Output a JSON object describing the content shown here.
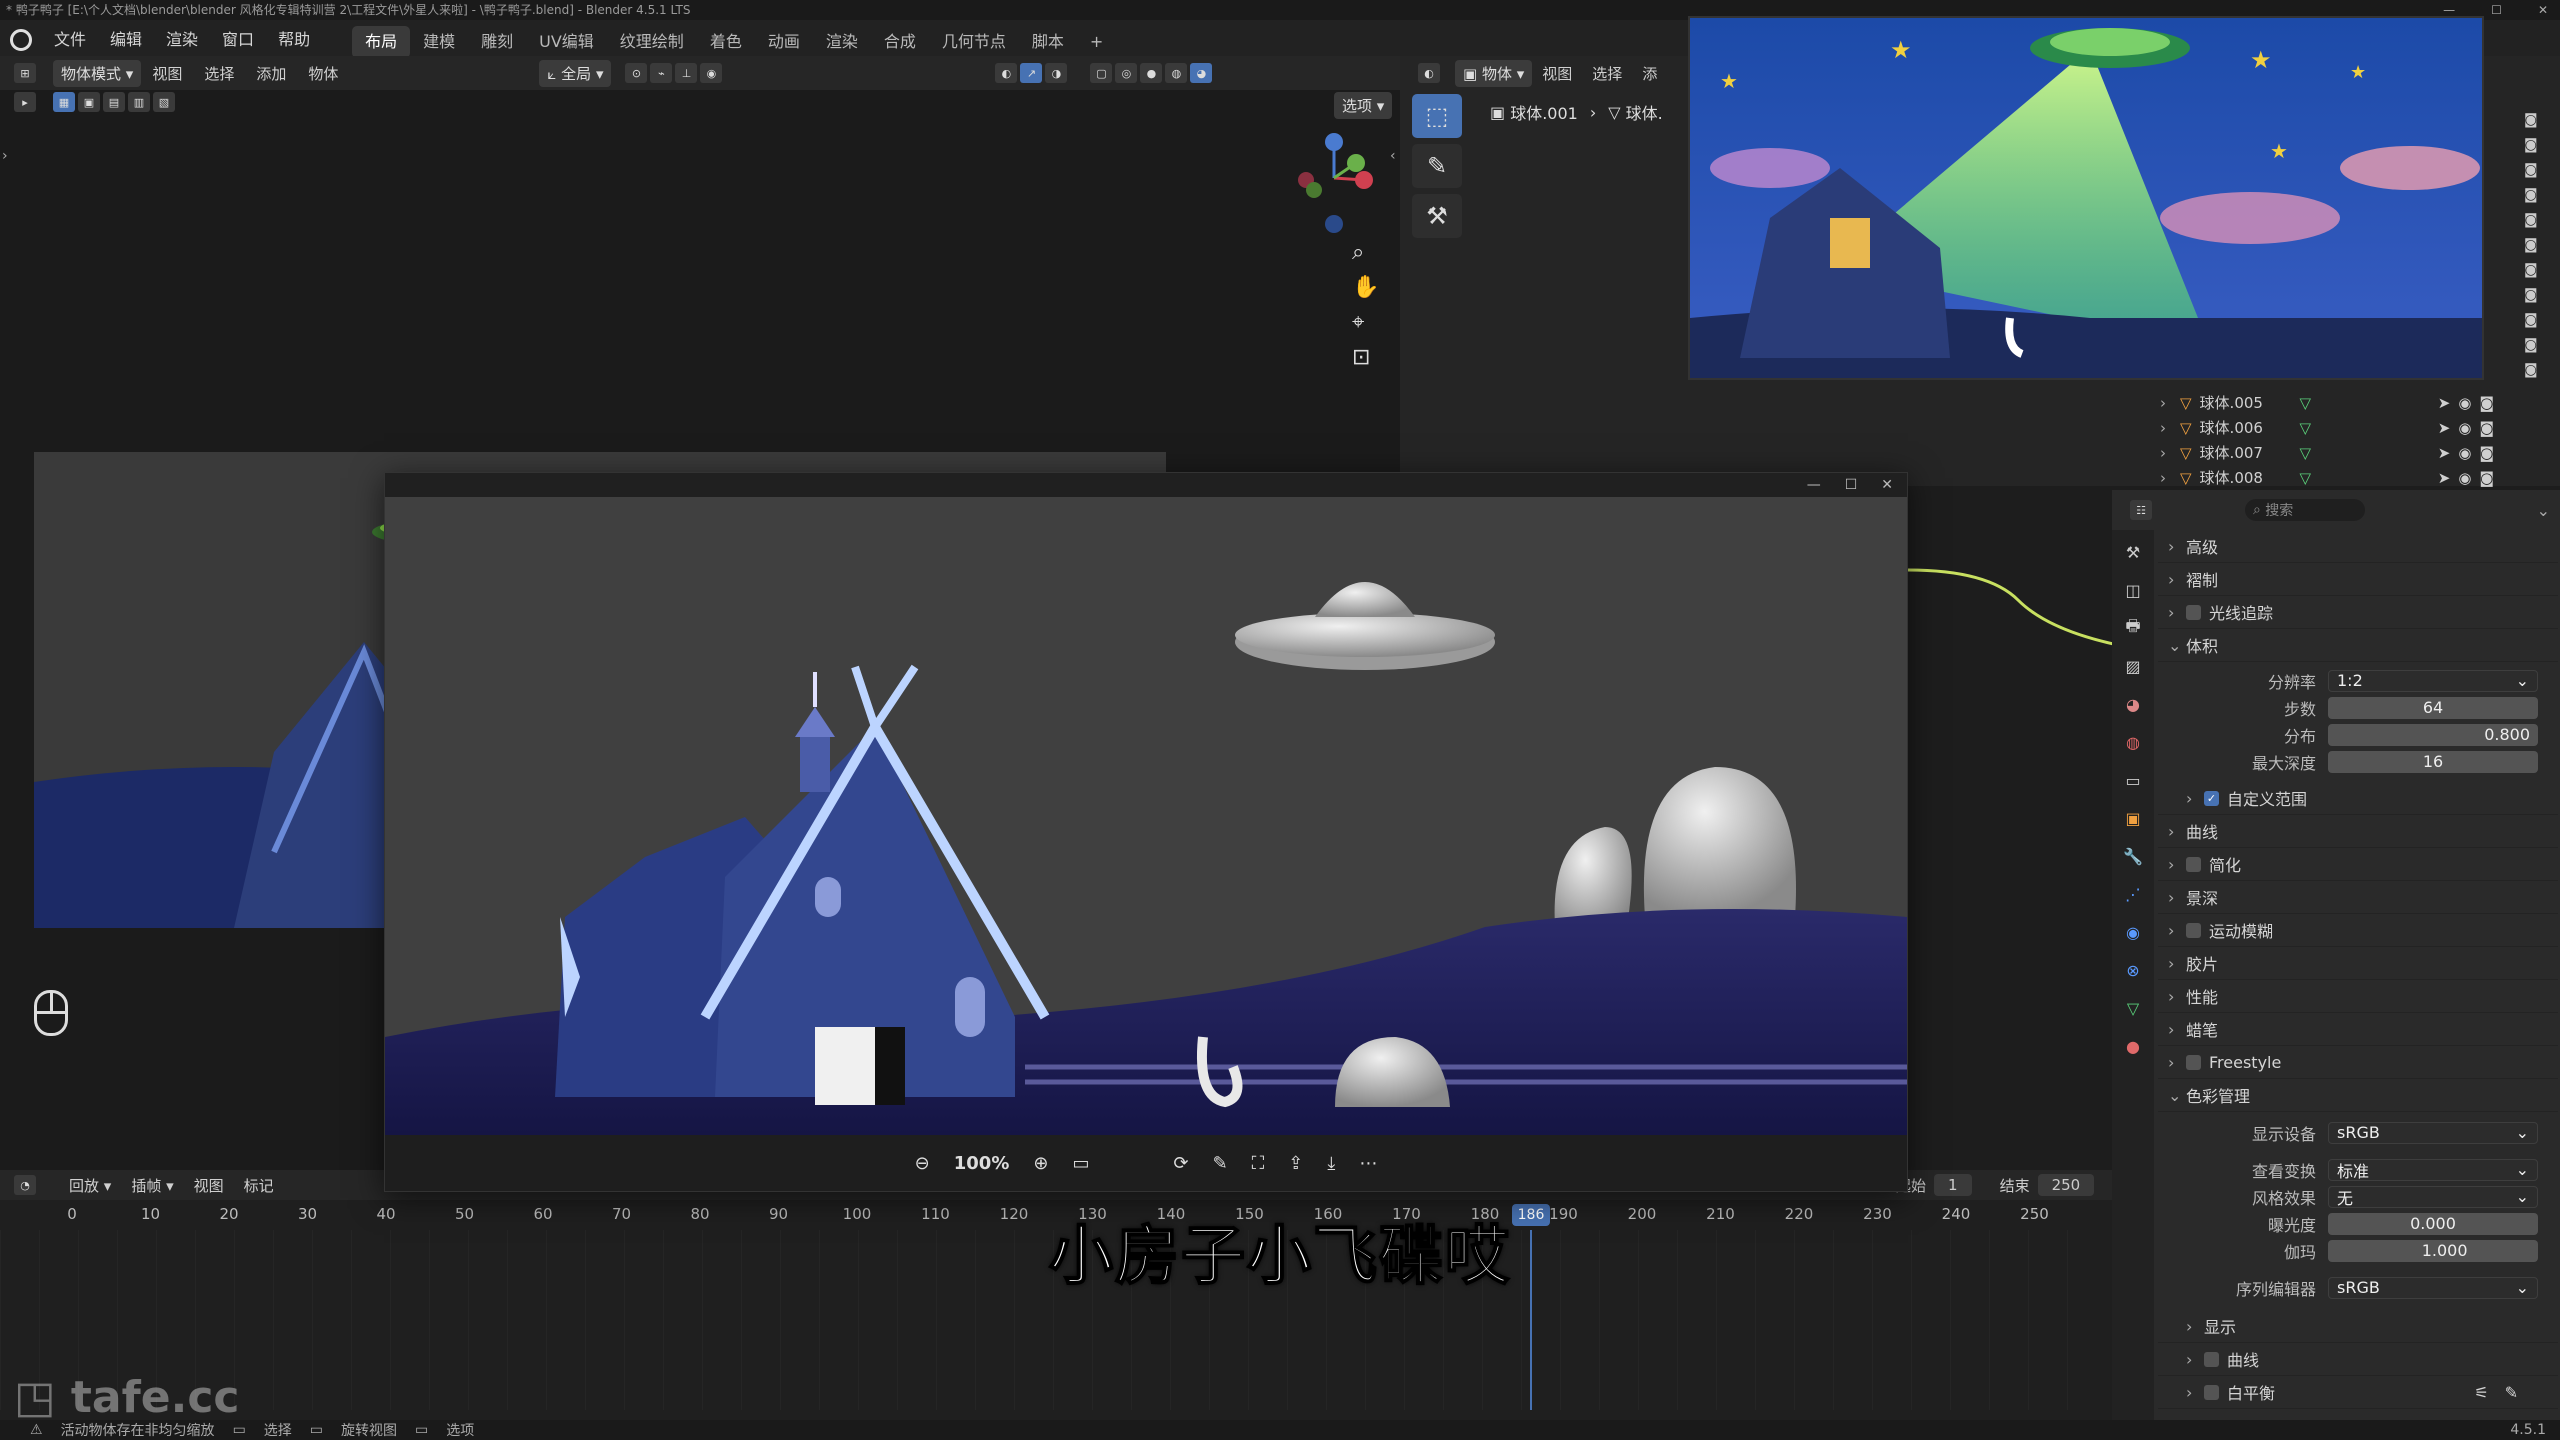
{
  "titlebar": {
    "text": "* 鸭子鸭子 [E:\\个人文档\\blender\\blender 风格化专辑特训营 2\\工程文件\\外星人来啦] - \\鸭子鸭子.blend] - Blender 4.5.1 LTS"
  },
  "menu": {
    "items": [
      "文件",
      "编辑",
      "渲染",
      "窗口",
      "帮助"
    ],
    "workspaces": [
      "布局",
      "建模",
      "雕刻",
      "UV编辑",
      "纹理绘制",
      "着色",
      "动画",
      "渲染",
      "合成",
      "几何节点",
      "脚本"
    ],
    "add": "+"
  },
  "viewport_header": {
    "mode": "物体模式",
    "items": [
      "视图",
      "选择",
      "添加",
      "物体"
    ],
    "transform": "全局",
    "options": "选项"
  },
  "right_header": {
    "object_mode": "物体",
    "items": [
      "视图",
      "选择",
      "添"
    ],
    "breadcrumb_obj": "球体.001",
    "breadcrumb_mesh": "球体."
  },
  "outliner": {
    "rows": [
      {
        "name": "球体.005"
      },
      {
        "name": "球体.006"
      },
      {
        "name": "球体.007"
      },
      {
        "name": "球体.008"
      }
    ]
  },
  "properties": {
    "search_placeholder": "搜索",
    "sections_top": [
      "高级",
      "褶制",
      "光线追踪"
    ],
    "volume": {
      "title": "体积",
      "resolution_label": "分辨率",
      "resolution": "1:2",
      "steps_label": "步数",
      "steps": "64",
      "distribution_label": "分布",
      "distribution": "0.800",
      "distribution_fill": 0.8,
      "max_depth_label": "最大深度",
      "max_depth": "16",
      "custom_range": "自定义范围"
    },
    "sections_mid": [
      "曲线",
      "简化",
      "景深",
      "运动模糊",
      "胶片",
      "性能",
      "蜡笔",
      "Freestyle"
    ],
    "color_mgmt": {
      "title": "色彩管理",
      "display_label": "显示设备",
      "display": "sRGB",
      "view_label": "查看变换",
      "view": "标准",
      "look_label": "风格效果",
      "look": "无",
      "exposure_label": "曝光度",
      "exposure": "0.000",
      "gamma_label": "伽玛",
      "gamma": "1.000",
      "gamma_fill": 0.12,
      "sequencer_label": "序列编辑器",
      "sequencer": "sRGB"
    },
    "sections_bottom": [
      "显示",
      "曲线",
      "白平衡"
    ]
  },
  "timeline": {
    "items": [
      "回放",
      "插帧",
      "视图",
      "标记"
    ],
    "start_label": "起始",
    "start": "1",
    "end_label": "结束",
    "end": "250",
    "current_frame": "186",
    "ticks": [
      "0",
      "10",
      "20",
      "30",
      "40",
      "50",
      "60",
      "70",
      "80",
      "90",
      "100",
      "110",
      "120",
      "130",
      "140",
      "150",
      "160",
      "170",
      "180",
      "190",
      "200",
      "210",
      "220",
      "230",
      "240",
      "250"
    ]
  },
  "viewer": {
    "zoom": "100%",
    "minimize": "—",
    "maximize": "☐",
    "close": "✕"
  },
  "subtitle": "小房子小飞碟哎",
  "watermark": "tafe.cc",
  "statusbar": {
    "items": [
      "活动物体存在非均匀缩放",
      "选择",
      "旋转视图",
      "选项"
    ],
    "version": "4.5.1"
  },
  "colors": {
    "accent": "#4772b3",
    "bg": "#1d1d1d"
  }
}
